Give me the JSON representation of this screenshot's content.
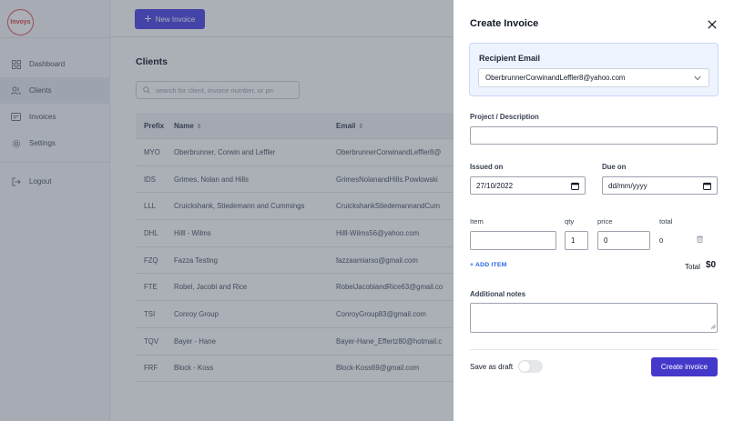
{
  "logo": {
    "text": "Invoys"
  },
  "sidebar": {
    "items": [
      {
        "label": "Dashboard",
        "icon": "grid-icon"
      },
      {
        "label": "Clients",
        "icon": "users-icon",
        "active": true
      },
      {
        "label": "Invoices",
        "icon": "invoice-icon"
      },
      {
        "label": "Settings",
        "icon": "gear-icon"
      }
    ],
    "logout": "Logout"
  },
  "topbar": {
    "new_invoice_label": "New Invoice"
  },
  "clients": {
    "title": "Clients",
    "search_placeholder": "search for client, invoice number, or pn",
    "columns": [
      "Prefix",
      "Name",
      "Email"
    ],
    "rows": [
      {
        "prefix": "MYO",
        "name": "Oberbrunner, Corwin and Leffler",
        "email": "OberbrunnerCorwinandLeffler8@"
      },
      {
        "prefix": "IDS",
        "name": "Grimes, Nolan and Hills",
        "email": "GrimesNolanandHills.Powlowski"
      },
      {
        "prefix": "LLL",
        "name": "Cruickshank, Stiedemann and Cummings",
        "email": "CruickshankStiedemannandCum"
      },
      {
        "prefix": "DHL",
        "name": "Hilll - Wilms",
        "email": "Hilll-Wilms56@yahoo.com"
      },
      {
        "prefix": "FZQ",
        "name": "Fazza Testing",
        "email": "fazzaamiarso@gmail.com"
      },
      {
        "prefix": "FTE",
        "name": "Robel, Jacobi and Rice",
        "email": "RobelJacobiandRice63@gmail.co"
      },
      {
        "prefix": "TSI",
        "name": "Conroy Group",
        "email": "ConroyGroup83@gmail.com"
      },
      {
        "prefix": "TQV",
        "name": "Bayer - Hane",
        "email": "Bayer-Hane_Effertz80@hotmail.c"
      },
      {
        "prefix": "FRF",
        "name": "Block - Koss",
        "email": "Block-Koss69@gmail.com"
      }
    ]
  },
  "drawer": {
    "title": "Create Invoice",
    "recipient": {
      "label": "Recipient Email",
      "selected": "OberbrunnerCorwinandLeffler8@yahoo.com"
    },
    "project": {
      "label": "Project / Description",
      "value": ""
    },
    "issued_on": {
      "label": "Issued on",
      "value": "27/10/2022"
    },
    "due_on": {
      "label": "Due on",
      "value": "dd/mm/yyyy"
    },
    "items": {
      "headers": {
        "item": "Item",
        "qty": "qty",
        "price": "price",
        "total": "total"
      },
      "rows": [
        {
          "item": "",
          "qty": "1",
          "price": "0",
          "total": "0"
        }
      ],
      "add_label": "+ ADD ITEM"
    },
    "total": {
      "label": "Total",
      "value": "$0"
    },
    "notes": {
      "label": "Additional notes",
      "value": ""
    },
    "draft": {
      "label": "Save as draft",
      "on": false
    },
    "submit_label": "Create invoice"
  },
  "colors": {
    "accent": "#4f46e5",
    "submit": "#4338ca",
    "link": "#2563eb",
    "recipient_bg": "#eef4ff",
    "overlay": "rgba(55,65,81,0.42)"
  }
}
